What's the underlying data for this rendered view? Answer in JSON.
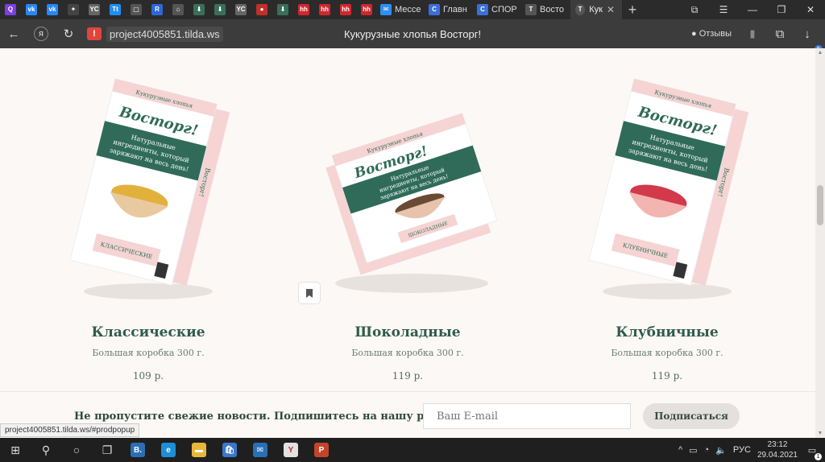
{
  "browser": {
    "tabs": [
      {
        "kind": "icon",
        "name": "yandex-tab-icon",
        "color": "#7b3fe4",
        "glyph": "Q"
      },
      {
        "kind": "icon",
        "name": "vk-tab-icon",
        "color": "#2787f5",
        "glyph": "vk"
      },
      {
        "kind": "icon",
        "name": "vk-tab-icon-2",
        "color": "#2787f5",
        "glyph": "vk"
      },
      {
        "kind": "icon",
        "name": "sparkle-tab-icon",
        "color": "#444444",
        "glyph": "✦"
      },
      {
        "kind": "icon",
        "name": "news-tab-icon",
        "color": "#666666",
        "glyph": "YC"
      },
      {
        "kind": "icon",
        "name": "tt-tab-icon",
        "color": "#1f8ef1",
        "glyph": "Tt"
      },
      {
        "kind": "icon",
        "name": "window-tab-icon",
        "color": "#555555",
        "glyph": "▢"
      },
      {
        "kind": "icon",
        "name": "r-tab-icon",
        "color": "#2f67d8",
        "glyph": "R"
      },
      {
        "kind": "icon",
        "name": "museum-tab-icon",
        "color": "#555555",
        "glyph": "⌂"
      },
      {
        "kind": "icon",
        "name": "pin-tab-icon",
        "color": "#3a6f5a",
        "glyph": "⬇"
      },
      {
        "kind": "icon",
        "name": "pin-tab-icon-2",
        "color": "#3a6f5a",
        "glyph": "⬇"
      },
      {
        "kind": "icon",
        "name": "news-tab-icon-2",
        "color": "#666666",
        "glyph": "YC"
      },
      {
        "kind": "icon",
        "name": "red-tab-icon",
        "color": "#c0302a",
        "glyph": "●"
      },
      {
        "kind": "icon",
        "name": "pin-tab-icon-3",
        "color": "#3a6f5a",
        "glyph": "⬇"
      },
      {
        "kind": "icon",
        "name": "hh-tab-icon",
        "color": "#d0262d",
        "glyph": "hh"
      },
      {
        "kind": "icon",
        "name": "hh-tab-icon-2",
        "color": "#d0262d",
        "glyph": "hh"
      },
      {
        "kind": "icon",
        "name": "hh-tab-icon-3",
        "color": "#d0262d",
        "glyph": "hh"
      },
      {
        "kind": "icon",
        "name": "hh-tab-icon-4",
        "color": "#d0262d",
        "glyph": "hh"
      },
      {
        "kind": "wide",
        "name": "messenger-tab",
        "color": "#2e8ff0",
        "glyph": "✉",
        "label": "Мессе"
      },
      {
        "kind": "wide",
        "name": "main-tab",
        "color": "#3b6fd8",
        "glyph": "C",
        "label": "Главн"
      },
      {
        "kind": "wide",
        "name": "sport-tab",
        "color": "#3b6fd8",
        "glyph": "C",
        "label": "СПОР"
      },
      {
        "kind": "wide",
        "name": "vostorg-tab",
        "color": "#555555",
        "glyph": "T",
        "label": "Восто"
      }
    ],
    "active_tab": {
      "glyph": "T",
      "label": "Кук",
      "close": "✕"
    },
    "new_tab": "+",
    "url": "project4005851.tilda.ws",
    "page_title": "Кукурузные хлопья Восторг!",
    "reviews_label": "Отзывы",
    "downloads_badge": "5"
  },
  "products": [
    {
      "name": "Классические",
      "desc": "Большая коробка 300 г.",
      "price": "109 р.",
      "flavor_label": "КЛАССИЧЕСКИЕ",
      "bowl_color": "#e2b13c",
      "bowl_base": "#e9c9a0"
    },
    {
      "name": "Шоколадные",
      "desc": "Большая коробка 300 г.",
      "price": "119 р.",
      "flavor_label": "ШОКОЛАДНЫЕ",
      "bowl_color": "#6b4a34",
      "bowl_base": "#e7c2ac"
    },
    {
      "name": "Клубничные",
      "desc": "Большая коробка 300 г.",
      "price": "119 р.",
      "flavor_label": "КЛУБНИЧНЫЕ",
      "bowl_color": "#d2394a",
      "bowl_base": "#f2b5b0"
    }
  ],
  "box": {
    "top_label": "Кукурузные хлопья",
    "brand": "Восторг!",
    "tagline_1": "Натуральные",
    "tagline_2": "ингредиенты, который",
    "tagline_3": "заряжают на весь день!",
    "side_text": "Восторг!",
    "green": "#2f6b58",
    "pink": "#f5d4d3"
  },
  "newsletter": {
    "text": "Не пропустите свежие новости. Подпишитесь на нашу рассылку!",
    "email_placeholder": "Ваш E-mail",
    "subscribe_label": "Подписаться"
  },
  "status_link": "project4005851.tilda.ws/#prodpopup",
  "taskbar": {
    "items": [
      {
        "name": "windows-start-icon",
        "glyph": "⊞",
        "color": ""
      },
      {
        "name": "search-icon",
        "glyph": "⚲",
        "color": ""
      },
      {
        "name": "cortana-icon",
        "glyph": "○",
        "color": ""
      },
      {
        "name": "task-view-icon",
        "glyph": "❐",
        "color": ""
      },
      {
        "name": "b-app-icon",
        "glyph": "B.",
        "color": "#2a6fb5"
      },
      {
        "name": "edge-icon",
        "glyph": "e",
        "color": "#1d8fd6"
      },
      {
        "name": "folder-icon",
        "glyph": "▬",
        "color": "#e8b73a"
      },
      {
        "name": "store-icon",
        "glyph": "🛍",
        "color": "#3a78c9"
      },
      {
        "name": "mail-icon",
        "glyph": "✉",
        "color": "#2a6fb5"
      },
      {
        "name": "yandex-browser-icon",
        "glyph": "Y",
        "color": "#e2e2e2"
      },
      {
        "name": "powerpoint-icon",
        "glyph": "P",
        "color": "#c4442a"
      }
    ],
    "lang": "РУС",
    "time": "23:12",
    "date": "29.04.2021",
    "notifications": "1"
  }
}
